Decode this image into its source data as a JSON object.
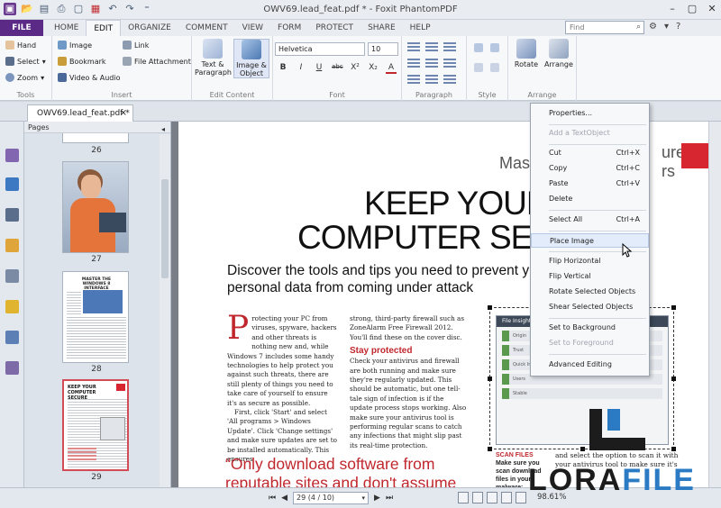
{
  "window": {
    "title": "OWV69.lead_feat.pdf * - Foxit PhantomPDF"
  },
  "menu": {
    "file": "FILE",
    "tabs": [
      "HOME",
      "EDIT",
      "ORGANIZE",
      "COMMENT",
      "VIEW",
      "FORM",
      "PROTECT",
      "SHARE",
      "HELP"
    ],
    "active": "EDIT",
    "find_placeholder": "Find"
  },
  "ribbon": {
    "tools": {
      "label": "Tools",
      "hand": "Hand",
      "select": "Select",
      "zoom": "Zoom"
    },
    "insert": {
      "label": "Insert",
      "image": "Image",
      "link": "Link",
      "bookmark": "Bookmark",
      "file_attachment": "File Attachment",
      "video_audio": "Video & Audio"
    },
    "edit_content": {
      "label": "Edit Content",
      "text_paragraph": "Text & Paragraph",
      "image_object": "Image & Object"
    },
    "font": {
      "label": "Font",
      "family": "Helvetica",
      "size": "10",
      "buttons": [
        "B",
        "I",
        "U",
        "abc",
        "X²",
        "X₂",
        "A"
      ]
    },
    "paragraph": {
      "label": "Paragraph"
    },
    "style": {
      "label": "Style"
    },
    "arrange": {
      "label": "Arrange",
      "rotate": "Rotate",
      "arrange": "Arrange"
    }
  },
  "doc_tab": {
    "name": "OWV69.lead_feat.pdf *"
  },
  "pages_panel": {
    "title": "Pages",
    "thumbnails": [
      {
        "label": "26"
      },
      {
        "label": "27"
      },
      {
        "label": "28"
      },
      {
        "label": "29",
        "selected": true
      }
    ],
    "thumb28_title": "MASTER THE WINDOWS 8 INTERFACE",
    "thumb29_title": "KEEP YOUR COMPUTER SECURE"
  },
  "article": {
    "kicker": "Maste",
    "kicker_right": "ure",
    "kicker_right2": "rs",
    "headline1": "KEEP YOUR",
    "headline2": "COMPUTER SEC",
    "subhead": "Discover the tools and tips you need to prevent y personal data from coming under attack",
    "dropcap": "P",
    "col1": "rotecting your PC from viruses, spyware, hackers and other threats is nothing new and, while Windows 7 includes some handy technologies to help protect you against such threats, there are still plenty of things you need to take care of yourself to ensure it's as secure as possible.",
    "col1b": "First, click 'Start' and select 'All programs > Windows Update'. Click 'Change settings' and make sure updates are set to be installed automatically. This ensures",
    "col2a": "strong, third-party firewall such as ZoneAlarm Free Firewall 2012. You'll find these on the cover disc.",
    "stay_heading": "Stay protected",
    "col2b": "Check your antivirus and firewall are both running and make sure they're regularly updated. This should be automatic, but one tell-tale sign of infection is if the update process stops working. Also make sure your antivirus tool is performing regular scans to catch any infections that might slip past its real-time protection.",
    "quote": "“Only download software from reputable sites and don't assume",
    "scan_heading": "SCAN FILES",
    "scan_text": "Make sure you scan download files in your malware:",
    "col3": "and select the option to scan it with your antivirus tool to make sure it's",
    "shot_title": "File Insight",
    "shot_rows": [
      "Origin",
      "Trust",
      "Quick Info",
      "Users",
      "Stable"
    ]
  },
  "context_menu": {
    "items": [
      {
        "label": "Properties...",
        "shortcut": "",
        "disabled": false
      },
      {
        "label": "Add a TextObject",
        "shortcut": "",
        "disabled": true
      },
      {
        "label": "Cut",
        "shortcut": "Ctrl+X",
        "disabled": false
      },
      {
        "label": "Copy",
        "shortcut": "Ctrl+C",
        "disabled": false
      },
      {
        "label": "Paste",
        "shortcut": "Ctrl+V",
        "disabled": false
      },
      {
        "label": "Delete",
        "shortcut": "",
        "disabled": false
      },
      {
        "label": "Select All",
        "shortcut": "Ctrl+A",
        "disabled": false
      },
      {
        "label": "Place Image",
        "shortcut": "",
        "disabled": false,
        "hover": true
      },
      {
        "label": "Flip Horizontal",
        "shortcut": "",
        "disabled": false
      },
      {
        "label": "Flip Vertical",
        "shortcut": "",
        "disabled": false
      },
      {
        "label": "Rotate Selected Objects",
        "shortcut": "",
        "disabled": false
      },
      {
        "label": "Shear Selected Objects",
        "shortcut": "",
        "disabled": false
      },
      {
        "label": "Set to Background",
        "shortcut": "",
        "disabled": false
      },
      {
        "label": "Set to Foreground",
        "shortcut": "",
        "disabled": true
      },
      {
        "label": "Advanced Editing",
        "shortcut": "",
        "disabled": false
      }
    ]
  },
  "status": {
    "page": "29 (4 / 10)",
    "zoom": "98.61%"
  },
  "watermark": {
    "part1": "LORA",
    "part2": "FILE"
  },
  "colors": {
    "file_tab": "#5b2a86",
    "accent_red": "#c0272d",
    "ribbon_bg": "#f7f8fa",
    "watermark_blue": "#2a7bc4"
  }
}
